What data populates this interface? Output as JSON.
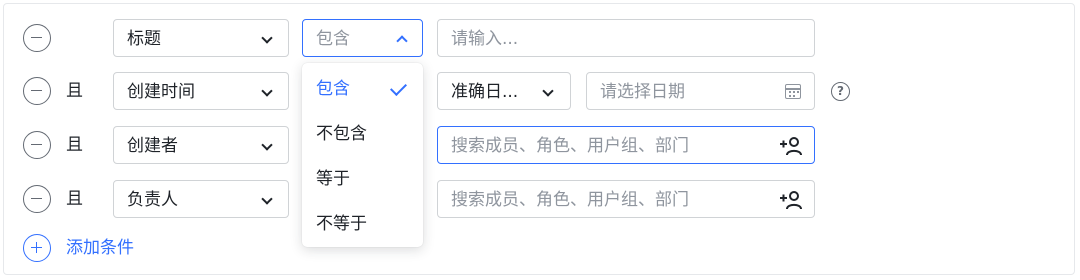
{
  "conditions": [
    {
      "field": "标题",
      "operator": "包含",
      "input_placeholder": "请输入..."
    },
    {
      "conjunction": "且",
      "field": "创建时间",
      "date_mode": "准确日...",
      "date_placeholder": "请选择日期",
      "help": "?"
    },
    {
      "conjunction": "且",
      "field": "创建者",
      "member_placeholder": "搜索成员、角色、用户组、部门"
    },
    {
      "conjunction": "且",
      "field": "负责人",
      "member_placeholder": "搜索成员、角色、用户组、部门"
    }
  ],
  "operator_dropdown": {
    "options": [
      "包含",
      "不包含",
      "等于",
      "不等于"
    ],
    "selected": "包含"
  },
  "add_condition_label": "添加条件",
  "colors": {
    "accent": "#3370ff",
    "border": "#d0d3d6",
    "text": "#1f2329",
    "placeholder": "#8f959e"
  },
  "icons": {
    "remove": "minus-circle-icon",
    "add": "plus-circle-icon",
    "calendar": "calendar-icon",
    "help": "question-circle-icon",
    "member": "add-user-icon"
  }
}
